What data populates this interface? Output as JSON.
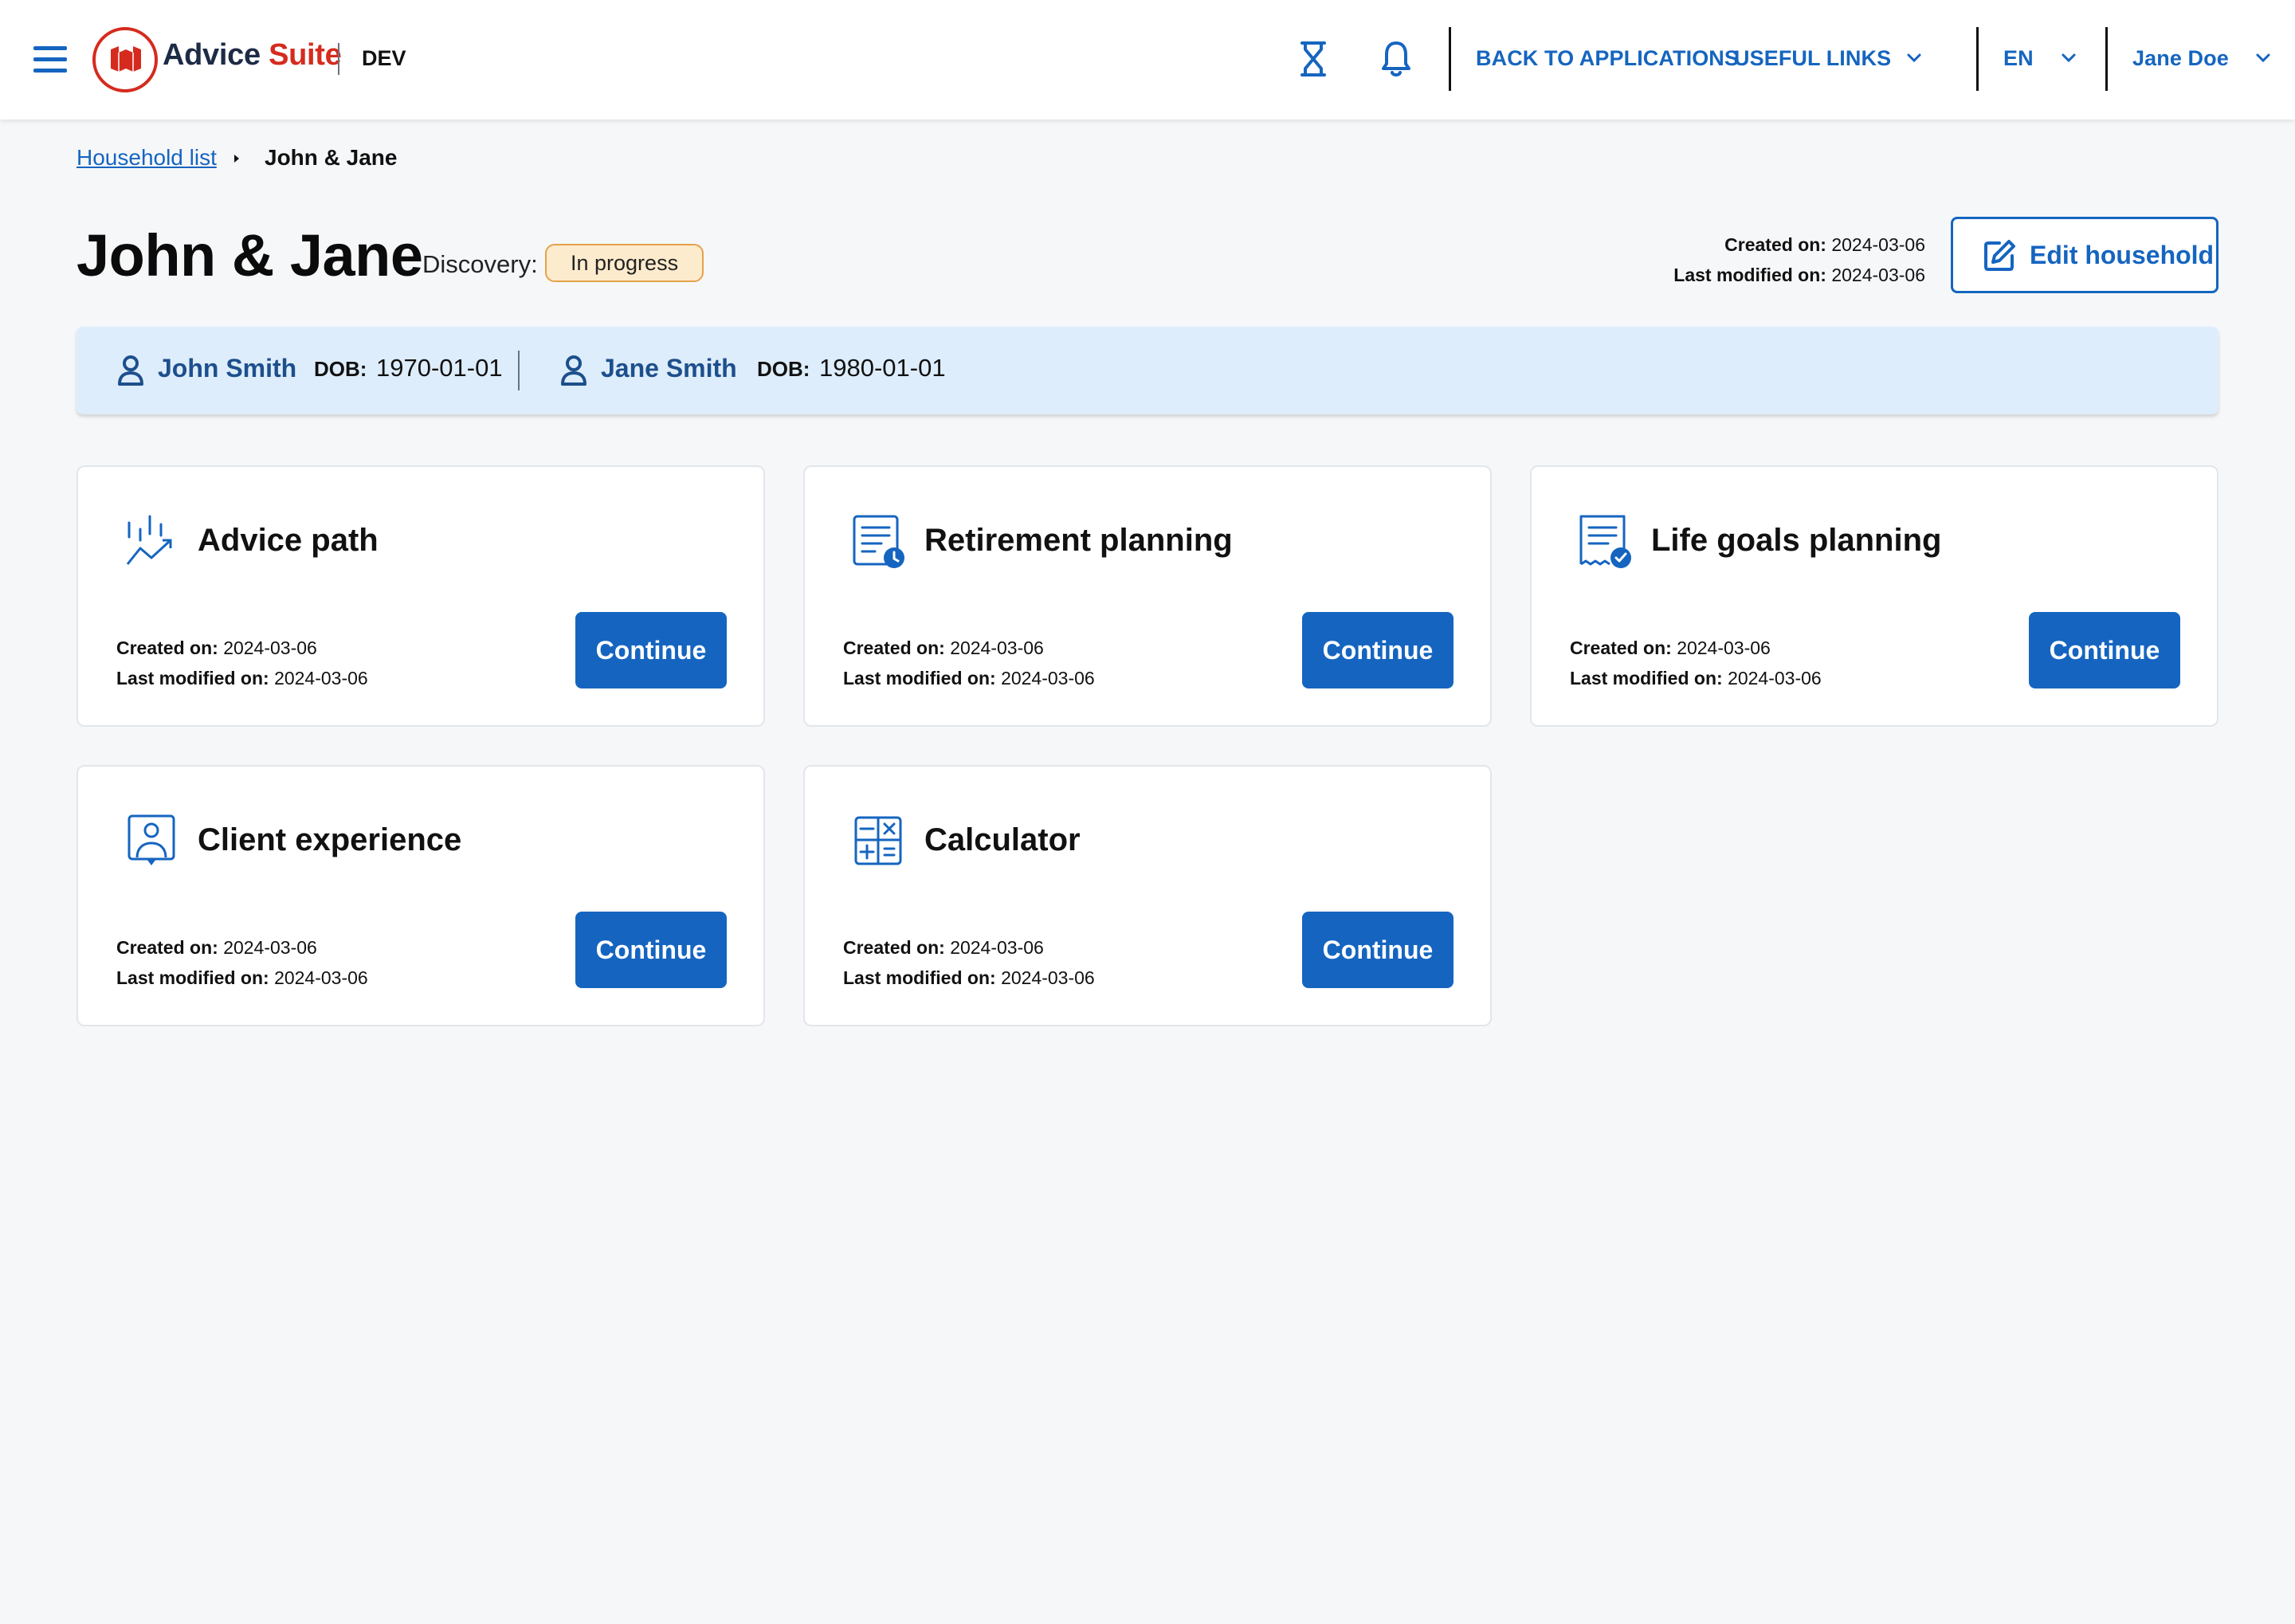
{
  "header": {
    "brand_part1": "Advice",
    "brand_part2": "Suite",
    "env": "DEV",
    "back_label": "BACK TO APPLICATIONS",
    "links_label": "USEFUL LINKS",
    "lang": "EN",
    "user": "Jane Doe",
    "icons": [
      "menu-icon",
      "maple-leaf-icon",
      "hourglass-icon",
      "bell-icon",
      "chevron-down-icon"
    ]
  },
  "breadcrumb": {
    "parent": "Household list",
    "current": "John & Jane"
  },
  "household": {
    "title": "John & Jane",
    "discovery_label": "Discovery:",
    "status": "In progress",
    "created_label": "Created on:",
    "created": "2024-03-06",
    "modified_label": "Last modified on:",
    "modified": "2024-03-06",
    "edit_label": "Edit household"
  },
  "members": [
    {
      "name": "John Smith",
      "dob_label": "DOB:",
      "dob": "1970-01-01"
    },
    {
      "name": "Jane Smith",
      "dob_label": "DOB:",
      "dob": "1980-01-01"
    }
  ],
  "cards": [
    {
      "title": "Advice path",
      "icon": "chart-trend-icon",
      "created_label": "Created on:",
      "created": "2024-03-06",
      "modified_label": "Last modified on:",
      "modified": "2024-03-06",
      "button": "Continue"
    },
    {
      "title": "Retirement planning",
      "icon": "document-clock-icon",
      "created_label": "Created on:",
      "created": "2024-03-06",
      "modified_label": "Last modified on:",
      "modified": "2024-03-06",
      "button": "Continue"
    },
    {
      "title": "Life goals planning",
      "icon": "document-check-icon",
      "created_label": "Created on:",
      "created": "2024-03-06",
      "modified_label": "Last modified on:",
      "modified": "2024-03-06",
      "button": "Continue"
    },
    {
      "title": "Client experience",
      "icon": "user-badge-icon",
      "created_label": "Created on:",
      "created": "2024-03-06",
      "modified_label": "Last modified on:",
      "modified": "2024-03-06",
      "button": "Continue"
    },
    {
      "title": "Calculator",
      "icon": "calculator-icon",
      "created_label": "Created on:",
      "created": "2024-03-06",
      "modified_label": "Last modified on:",
      "modified": "2024-03-06",
      "button": "Continue"
    }
  ],
  "colors": {
    "primary": "#1565c0",
    "brand_red": "#d52b1e",
    "badge_bg": "#fdebcd",
    "badge_border": "#e5a24a",
    "member_strip": "#deedfb",
    "page_bg": "#f6f7f9"
  }
}
